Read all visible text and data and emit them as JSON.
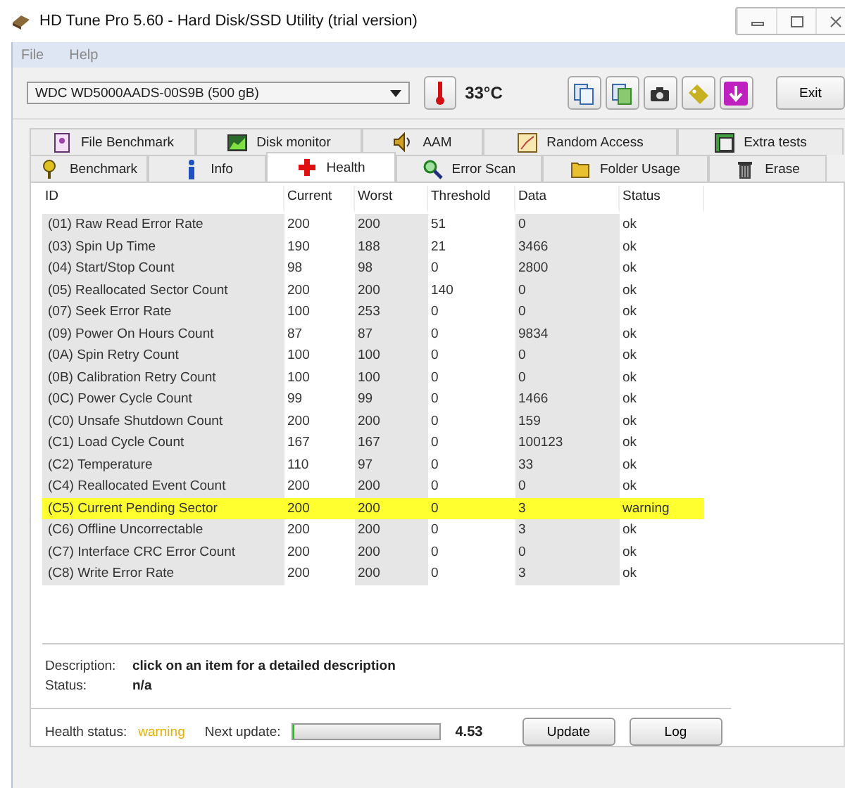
{
  "window": {
    "title": "HD Tune Pro 5.60 - Hard Disk/SSD Utility (trial version)"
  },
  "menu": [
    "File",
    "Help"
  ],
  "toolbar": {
    "drive": "WDC    WD5000AADS-00S9B (500 gB)",
    "temperature": "33°C",
    "exit_button": "Exit"
  },
  "tab_rows": [
    [
      {
        "label": "File Benchmark",
        "selected": false
      },
      {
        "label": "Disk monitor",
        "selected": false
      },
      {
        "label": "AAM",
        "selected": false
      },
      {
        "label": "Random Access",
        "selected": false
      },
      {
        "label": "Extra tests",
        "selected": false
      }
    ],
    [
      {
        "label": "Benchmark",
        "selected": false
      },
      {
        "label": "Info",
        "selected": false
      },
      {
        "label": "Health",
        "selected": true
      },
      {
        "label": "Error Scan",
        "selected": false
      },
      {
        "label": "Folder Usage",
        "selected": false
      },
      {
        "label": "Erase",
        "selected": false
      }
    ]
  ],
  "table": {
    "columns": [
      "ID",
      "Current",
      "Worst",
      "Threshold",
      "Data",
      "Status"
    ],
    "rows": [
      {
        "cells": [
          "(01) Raw Read Error Rate",
          "200",
          "200",
          "51",
          "0",
          "ok"
        ],
        "highlighted": false
      },
      {
        "cells": [
          "(03) Spin Up Time",
          "190",
          "188",
          "21",
          "3466",
          "ok"
        ],
        "highlighted": false
      },
      {
        "cells": [
          "(04) Start/Stop Count",
          "98",
          "98",
          "0",
          "2800",
          "ok"
        ],
        "highlighted": false
      },
      {
        "cells": [
          "(05) Reallocated Sector Count",
          "200",
          "200",
          "140",
          "0",
          "ok"
        ],
        "highlighted": false
      },
      {
        "cells": [
          "(07) Seek Error Rate",
          "100",
          "253",
          "0",
          "0",
          "ok"
        ],
        "highlighted": false
      },
      {
        "cells": [
          "(09) Power On Hours Count",
          "87",
          "87",
          "0",
          "9834",
          "ok"
        ],
        "highlighted": false
      },
      {
        "cells": [
          "(0A) Spin Retry Count",
          "100",
          "100",
          "0",
          "0",
          "ok"
        ],
        "highlighted": false
      },
      {
        "cells": [
          "(0B) Calibration Retry Count",
          "100",
          "100",
          "0",
          "0",
          "ok"
        ],
        "highlighted": false
      },
      {
        "cells": [
          "(0C) Power Cycle Count",
          "99",
          "99",
          "0",
          "1466",
          "ok"
        ],
        "highlighted": false
      },
      {
        "cells": [
          "(C0) Unsafe Shutdown Count",
          "200",
          "200",
          "0",
          "159",
          "ok"
        ],
        "highlighted": false
      },
      {
        "cells": [
          "(C1) Load Cycle Count",
          "167",
          "167",
          "0",
          "100123",
          "ok"
        ],
        "highlighted": false
      },
      {
        "cells": [
          "(C2) Temperature",
          "110",
          "97",
          "0",
          "33",
          "ok"
        ],
        "highlighted": false
      },
      {
        "cells": [
          "(C4) Reallocated Event Count",
          "200",
          "200",
          "0",
          "0",
          "ok"
        ],
        "highlighted": false
      },
      {
        "cells": [
          "(C5) Current Pending Sector",
          "200",
          "200",
          "0",
          "3",
          "warning"
        ],
        "highlighted": true
      },
      {
        "cells": [
          "(C6) Offline Uncorrectable",
          "200",
          "200",
          "0",
          "3",
          "ok"
        ],
        "highlighted": false
      },
      {
        "cells": [
          "(C7) Interface CRC Error Count",
          "200",
          "200",
          "0",
          "0",
          "ok"
        ],
        "highlighted": false
      },
      {
        "cells": [
          "(C8) Write Error Rate",
          "200",
          "200",
          "0",
          "3",
          "ok"
        ],
        "highlighted": false
      }
    ]
  },
  "details": [
    {
      "label": "Description:",
      "value": "click on an item for a detailed description"
    },
    {
      "label": "Status:",
      "value": "n/a"
    }
  ],
  "footer": {
    "health_label": "Health status:",
    "health_status": {
      "text": "warning",
      "kind": "warning"
    },
    "next_update_label": "Next update:",
    "progress": {
      "level": 0.01
    },
    "countdown": "4.53",
    "buttons": [
      "Update",
      "Log"
    ]
  }
}
